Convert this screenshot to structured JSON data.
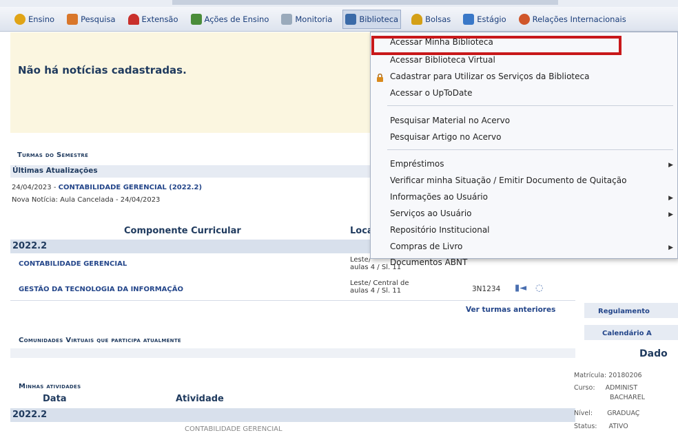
{
  "menu": {
    "items": [
      {
        "label": "Ensino",
        "color": "#e0a417"
      },
      {
        "label": "Pesquisa",
        "color": "#d9772b"
      },
      {
        "label": "Extensão",
        "color": "#c9302c"
      },
      {
        "label": "Ações de Ensino",
        "color": "#4a8c3a"
      },
      {
        "label": "Monitoria",
        "color": "#7a8aa0"
      },
      {
        "label": "Biblioteca",
        "color": "#3a6aa8"
      },
      {
        "label": "Bolsas",
        "color": "#d4a017"
      },
      {
        "label": "Estágio",
        "color": "#3a78c8"
      },
      {
        "label": "Relações Internacionais",
        "color": "#d0562a"
      }
    ]
  },
  "news": {
    "message": "Não há notícias cadastradas."
  },
  "turmas": {
    "title": "Turmas do Semestre",
    "updates_title": "Últimas Atualizações",
    "update_date": "24/04/2023 - ",
    "update_course": "CONTABILIDADE GERENCIAL (2022.2)",
    "update_note": "Nova Notícia: Aula Cancelada - 24/04/2023",
    "col_component": "Componente Curricular",
    "col_local": "Local",
    "year": "2022.2",
    "rows": [
      {
        "name": "CONTABILIDADE GERENCIAL",
        "local1": "Leste/",
        "local2": "aulas 4 / Sl. 11",
        "code": ""
      },
      {
        "name": "GESTÃO DA TECNOLOGIA DA INFORMAÇÃO",
        "local1": "Leste/ Central de",
        "local2": "aulas 4 / Sl. 11",
        "code": "3N1234"
      }
    ],
    "more_link": "Ver turmas anteriores"
  },
  "comunidades": {
    "title": "Comunidades Virtuais que participa atualmente"
  },
  "atividades": {
    "title": "Minhas atividades",
    "col_date": "Data",
    "col_activity": "Atividade",
    "year": "2022.2",
    "first_row": "CONTABILIDADE GERENCIAL"
  },
  "right_panel": {
    "regulamento": "Regulamento",
    "calendario": "Calendário A",
    "dados": "Dado",
    "fields": [
      {
        "label": "Matrícula:",
        "value": "20180206"
      },
      {
        "label": "Curso:",
        "value": "ADMINIST"
      },
      {
        "label": "",
        "value": "BACHAREL"
      },
      {
        "label": "Nível:",
        "value": "GRADUAÇ"
      },
      {
        "label": "Status:",
        "value": "ATIVO"
      }
    ]
  },
  "biblioteca_menu": {
    "group1": [
      "Acessar Minha Biblioteca",
      "Acessar Biblioteca Virtual",
      "Cadastrar para Utilizar os Serviços da Biblioteca",
      "Acessar o UpToDate"
    ],
    "group2": [
      "Pesquisar Material no Acervo",
      "Pesquisar Artigo no Acervo"
    ],
    "group3": [
      "Empréstimos",
      "Verificar minha Situação / Emitir Documento de Quitação",
      "Informações ao Usuário",
      "Serviços ao Usuário",
      "Repositório Institucional",
      "Compras de Livro",
      "Documentos ABNT"
    ]
  }
}
